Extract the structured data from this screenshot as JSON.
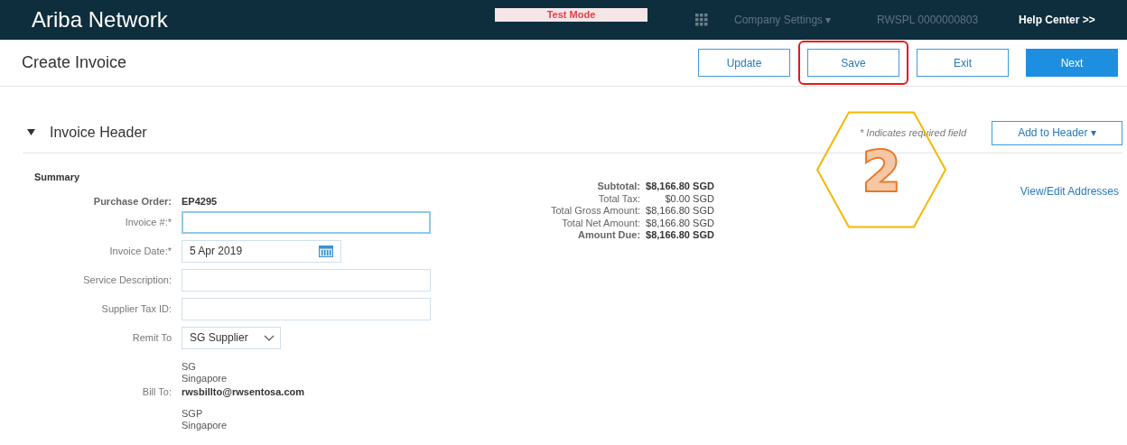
{
  "top_bar": {
    "logo": "Ariba Network",
    "mode_badge": "Test Mode",
    "company_menu": "Company Settings ▾",
    "account_id": "RWSPL 0000000803",
    "help": "Help Center >>"
  },
  "page": {
    "title": "Create Invoice",
    "buttons": [
      {
        "label": "Update",
        "kind": "outline",
        "highlighted": false
      },
      {
        "label": "Save",
        "kind": "outline",
        "highlighted": true
      },
      {
        "label": "Exit",
        "kind": "outline",
        "highlighted": false
      },
      {
        "label": "Next",
        "kind": "primary",
        "highlighted": false
      }
    ]
  },
  "section": {
    "title": "Invoice Header",
    "expanded": true,
    "required_note": "* Indicates required field",
    "add_button": "Add to Header ▾"
  },
  "summary": {
    "title": "Summary",
    "purchase_order_label": "Purchase Order:",
    "purchase_order": "EP4295",
    "fields": [
      {
        "label": "Invoice #:*",
        "kind": "text",
        "focused": true
      },
      {
        "label": "Invoice Date:*",
        "kind": "date",
        "value": "5 Apr 2019",
        "focused": false
      },
      {
        "label": "Service Description:",
        "kind": "text",
        "focused": false
      },
      {
        "label": "Supplier Tax ID:",
        "kind": "text",
        "focused": false
      },
      {
        "label": "Remit To",
        "kind": "select",
        "value": "SG Supplier",
        "focused": false
      }
    ],
    "bill_to_label": "Bill To:",
    "bill_to_lines_before": [
      "SG",
      "Singapore"
    ],
    "bill_to_email": "rwsbillto@rwsentosa.com",
    "bill_to_lines_after": [
      "SGP",
      "Singapore"
    ]
  },
  "totals": [
    {
      "label": "Subtotal:",
      "value": "$8,166.80 SGD",
      "bold": true
    },
    {
      "label": "Total Tax:",
      "value": "$0.00 SGD",
      "bold": false
    },
    {
      "label": "Total Gross Amount:",
      "value": "$8,166.80 SGD",
      "bold": false
    },
    {
      "label": "Total Net Amount:",
      "value": "$8,166.80 SGD",
      "bold": false
    },
    {
      "label": "Amount Due:",
      "value": "$8,166.80 SGD",
      "bold": true
    }
  ],
  "addresses_link": "View/Edit Addresses",
  "annotation": {
    "step": "2"
  }
}
